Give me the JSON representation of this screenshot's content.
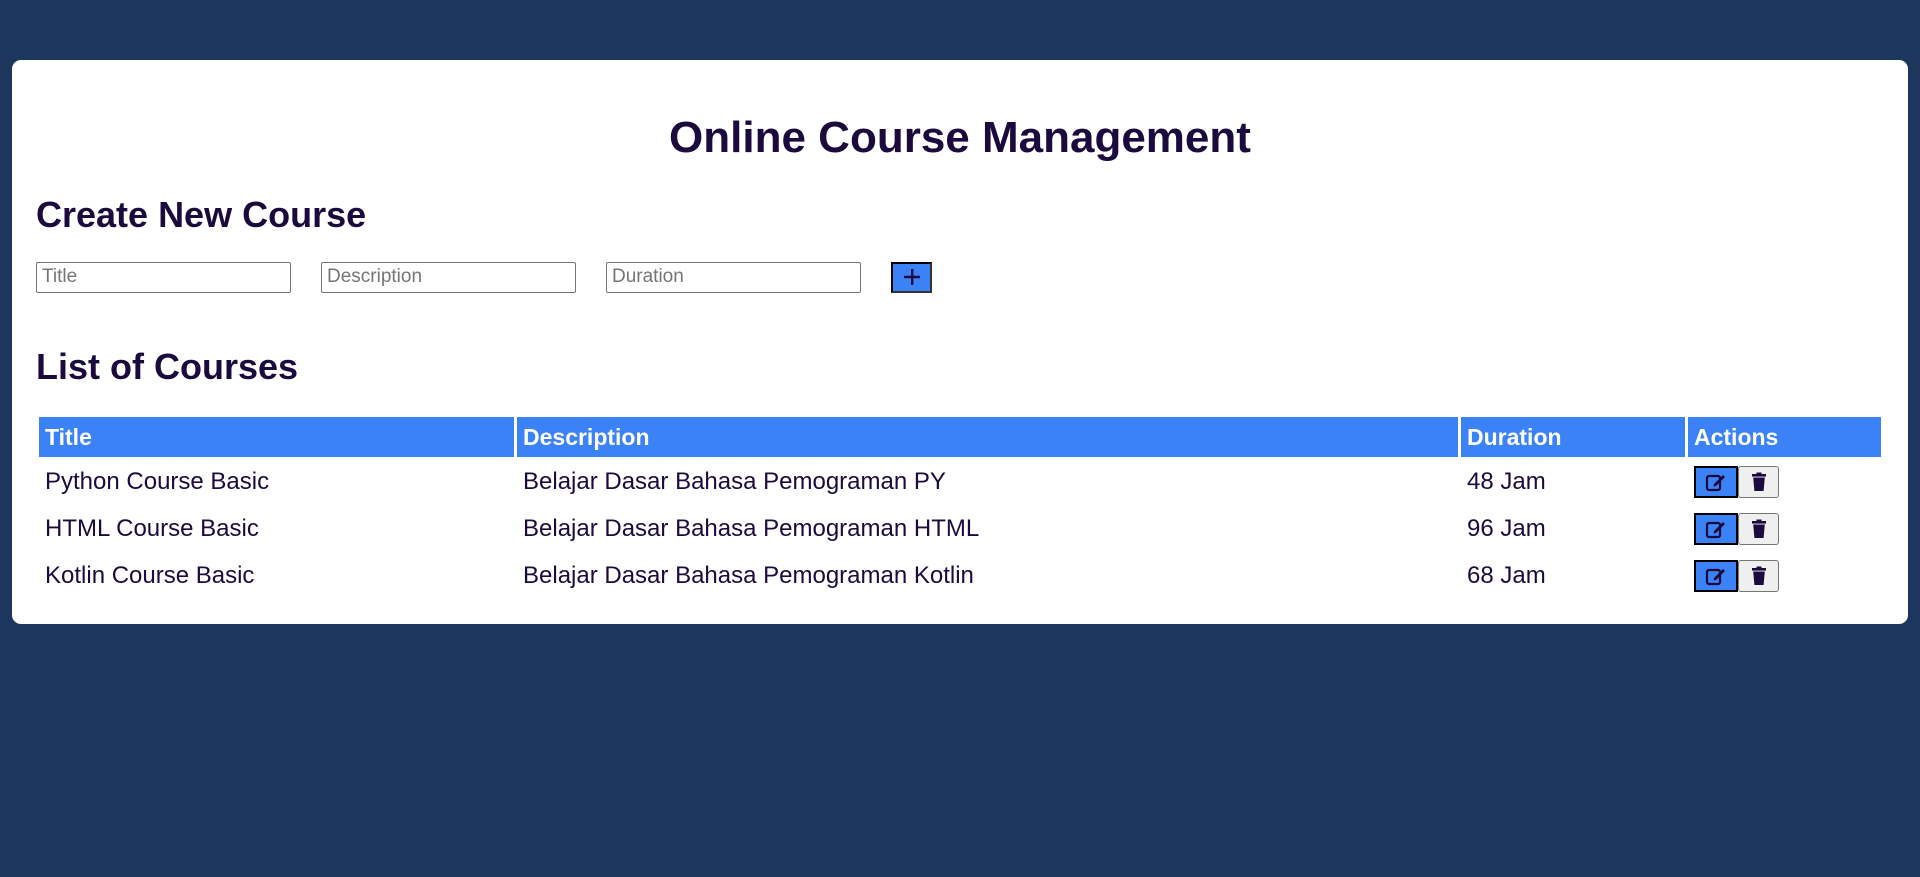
{
  "app": {
    "title": "Online Course Management"
  },
  "create_form": {
    "heading": "Create New Course",
    "title_placeholder": "Title",
    "description_placeholder": "Description",
    "duration_placeholder": "Duration",
    "add_icon": "plus-icon"
  },
  "course_list": {
    "heading": "List of Courses",
    "columns": [
      "Title",
      "Description",
      "Duration",
      "Actions"
    ],
    "rows": [
      {
        "title": "Python Course Basic",
        "description": "Belajar Dasar Bahasa Pemograman PY",
        "duration": "48 Jam"
      },
      {
        "title": "HTML Course Basic",
        "description": "Belajar Dasar Bahasa Pemograman HTML",
        "duration": "96 Jam"
      },
      {
        "title": "Kotlin Course Basic",
        "description": "Belajar Dasar Bahasa Pemograman Kotlin",
        "duration": "68 Jam"
      }
    ],
    "action_icons": [
      "edit-icon",
      "trash-icon"
    ]
  },
  "colors": {
    "background": "#1c365d",
    "card": "#ffffff",
    "accent": "#3b82f6",
    "text": "#1b0a3d"
  }
}
